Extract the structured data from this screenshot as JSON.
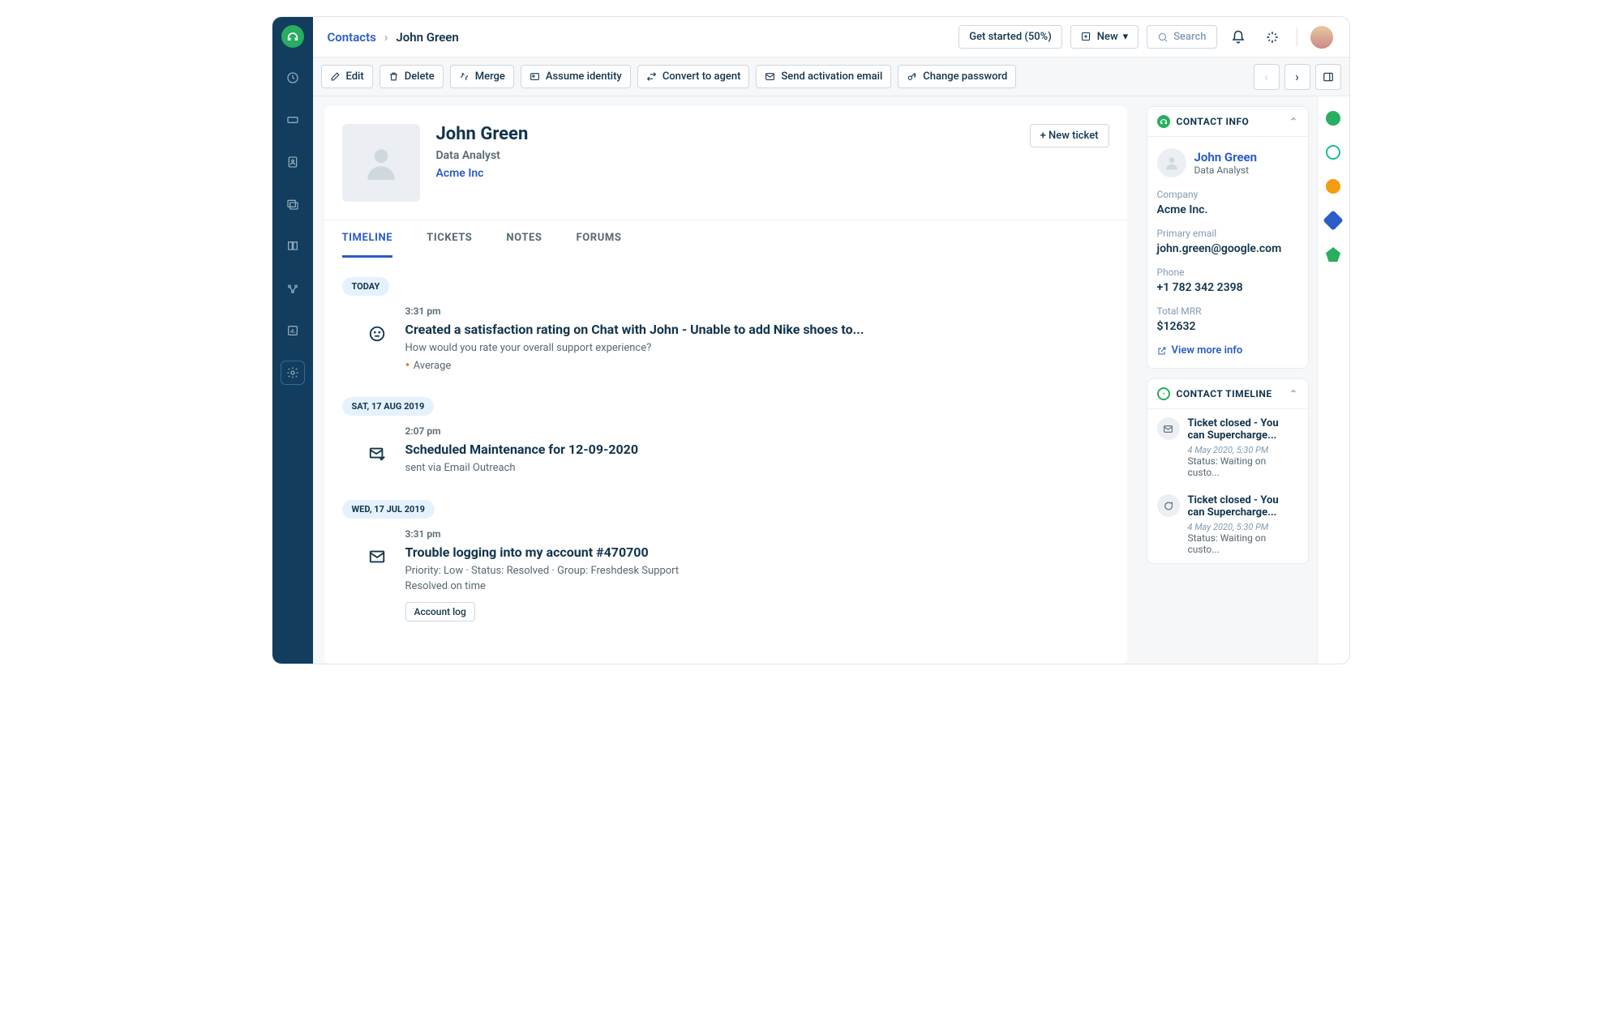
{
  "breadcrumb": {
    "root": "Contacts",
    "current": "John Green"
  },
  "header": {
    "getstarted": "Get started (50%)",
    "new": "New",
    "search_placeholder": "Search"
  },
  "actions": {
    "edit": "Edit",
    "delete": "Delete",
    "merge": "Merge",
    "assume": "Assume identity",
    "convert": "Convert to agent",
    "send": "Send activation email",
    "changepw": "Change password"
  },
  "profile": {
    "name": "John Green",
    "role": "Data Analyst",
    "company": "Acme Inc",
    "newticket": "+ New ticket"
  },
  "tabs": {
    "timeline": "TIMELINE",
    "tickets": "TICKETS",
    "notes": "NOTES",
    "forums": "FORUMS"
  },
  "timeline": [
    {
      "date": "TODAY",
      "items": [
        {
          "icon": "face",
          "time": "3:31 pm",
          "title": "Created a satisfaction rating on Chat with John - Unable to add Nike shoes to...",
          "sub": "How would you rate your overall support experience?",
          "rating": "Average"
        }
      ]
    },
    {
      "date": "SAT, 17 AUG 2019",
      "items": [
        {
          "icon": "mail-check",
          "time": "2:07 pm",
          "title": "Scheduled Maintenance for 12-09-2020",
          "sub": "sent via Email Outreach"
        }
      ]
    },
    {
      "date": "WED, 17 JUL 2019",
      "items": [
        {
          "icon": "mail",
          "time": "3:31 pm",
          "title": "Trouble logging into my account #470700",
          "sub": "Priority: Low   ·   Status: Resolved   ·   Group: Freshdesk Support",
          "sub2": "Resolved on time",
          "pill": "Account log"
        }
      ]
    }
  ],
  "contactinfo": {
    "header": "CONTACT INFO",
    "name": "John Green",
    "role": "Data Analyst",
    "company_label": "Company",
    "company": "Acme Inc.",
    "email_label": "Primary email",
    "email": "john.green@google.com",
    "phone_label": "Phone",
    "phone": "+1 782 342 2398",
    "mrr_label": "Total MRR",
    "mrr": "$12632",
    "viewmore": "View more info"
  },
  "ctimeline": {
    "header": "CONTACT TIMELINE",
    "items": [
      {
        "title": "Ticket closed - You can Supercharge...",
        "date": "4 May 2020, 5:30 PM",
        "status": "Status: Waiting on custo..."
      },
      {
        "title": "Ticket closed - You can Supercharge...",
        "date": "4 May 2020, 5:30 PM",
        "status": "Status: Waiting on custo..."
      }
    ]
  }
}
